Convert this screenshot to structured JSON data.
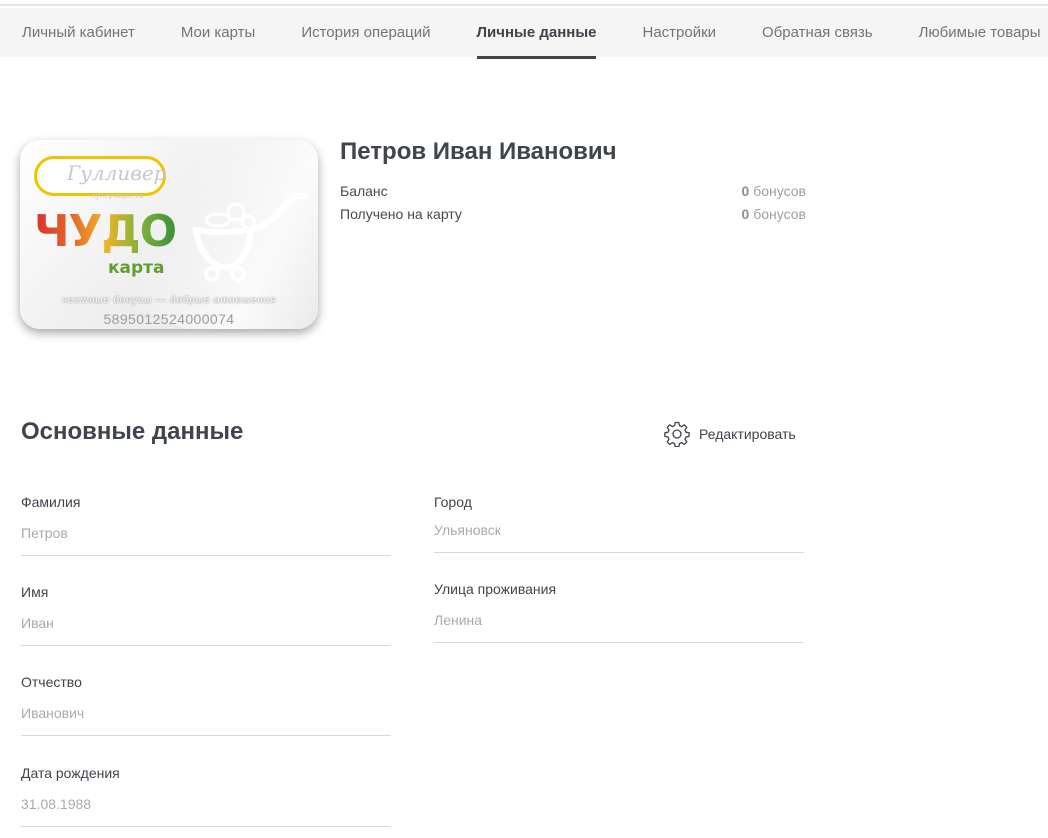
{
  "nav": {
    "tabs": [
      {
        "label": "Личный кабинет"
      },
      {
        "label": "Мои карты"
      },
      {
        "label": "История операций"
      },
      {
        "label": "Личные данные",
        "active": true
      },
      {
        "label": "Настройки"
      },
      {
        "label": "Обратная связь"
      },
      {
        "label": "Любимые товары"
      }
    ]
  },
  "card": {
    "logo": "Гулливер",
    "logo_sub": "супермаркеты",
    "brand": "ЧУДО",
    "brand_sub": "карта",
    "slogan": "честные бонусы — добрые отношения",
    "number": "5895012524000074"
  },
  "profile": {
    "name": "Петров Иван Иванович",
    "balance": {
      "label": "Баланс",
      "value": "0",
      "unit": "бонусов"
    },
    "received": {
      "label": "Получено на карту",
      "value": "0",
      "unit": "бонусов"
    }
  },
  "section": {
    "title": "Основные данные",
    "edit_label": "Редактировать"
  },
  "fields": {
    "surname": {
      "label": "Фамилия",
      "value": "Петров"
    },
    "name": {
      "label": "Имя",
      "value": "Иван"
    },
    "patronymic": {
      "label": "Отчество",
      "value": "Иванович"
    },
    "birthdate": {
      "label": "Дата рождения",
      "value": "31.08.1988"
    },
    "city": {
      "label": "Город",
      "value": "Ульяновск"
    },
    "street": {
      "label": "Улица проживания",
      "value": "Ленина"
    }
  },
  "colors": {
    "text_dark": "#3f454b",
    "text_muted": "#a6abb0",
    "tab_bar_bg": "#f5f5f5",
    "logo_yellow": "#f2c400"
  },
  "icons": {
    "edit": "gear-icon"
  }
}
